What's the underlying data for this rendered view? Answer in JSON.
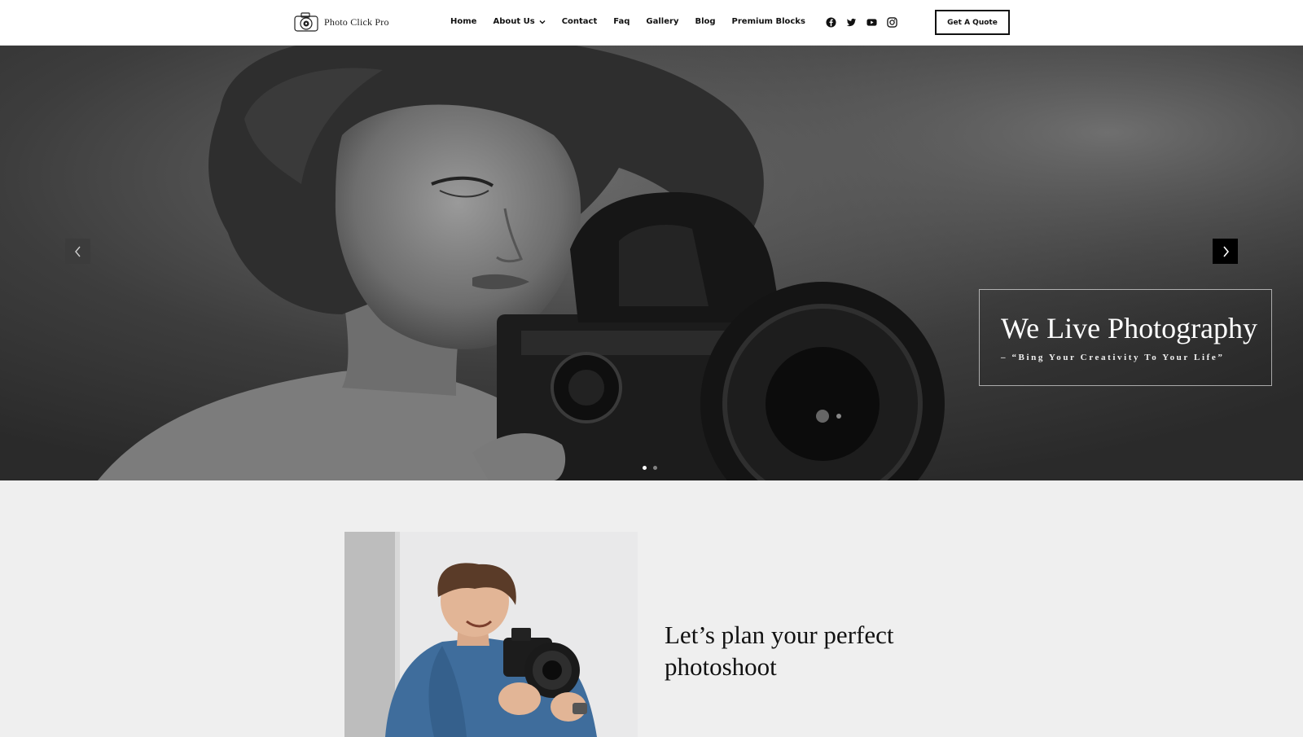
{
  "header": {
    "logo_text": "Photo Click Pro",
    "nav": [
      {
        "label": "Home"
      },
      {
        "label": "About Us",
        "has_dropdown": true
      },
      {
        "label": "Contact"
      },
      {
        "label": "Faq"
      },
      {
        "label": "Gallery"
      },
      {
        "label": "Blog"
      },
      {
        "label": "Premium Blocks"
      }
    ],
    "social_icons": [
      "facebook-icon",
      "twitter-icon",
      "youtube-icon",
      "instagram-icon"
    ],
    "cta_label": "Get A Quote"
  },
  "hero": {
    "title": "We Live Photography",
    "subtitle": "– “Bing Your Creativity To Your Life”",
    "slides_total": 2,
    "active_slide": 1
  },
  "section": {
    "heading": "Let’s plan your perfect photoshoot"
  },
  "colors": {
    "header_bg": "#ffffff",
    "text": "#111111",
    "section_bg": "#efefef",
    "next_arrow_bg": "#000000"
  }
}
